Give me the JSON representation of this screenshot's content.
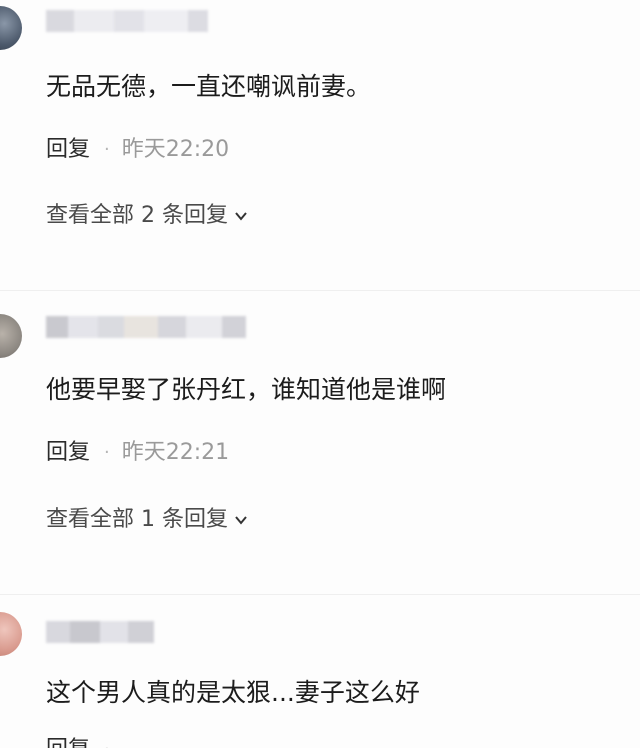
{
  "comments": [
    {
      "text": "无品无德，一直还嘲讽前妻。",
      "reply_label": "回复",
      "separator": "·",
      "time": "昨天22:20",
      "view_all": "查看全部 2 条回复"
    },
    {
      "text": "他要早娶了张丹红，谁知道他是谁啊",
      "reply_label": "回复",
      "separator": "·",
      "time": "昨天22:21",
      "view_all": "查看全部 1 条回复"
    },
    {
      "text": "这个男人真的是太狠...妻子这么好",
      "reply_label": "回复",
      "separator": "·",
      "time": ""
    }
  ],
  "icons": {
    "expand": "chevron-down-icon"
  }
}
